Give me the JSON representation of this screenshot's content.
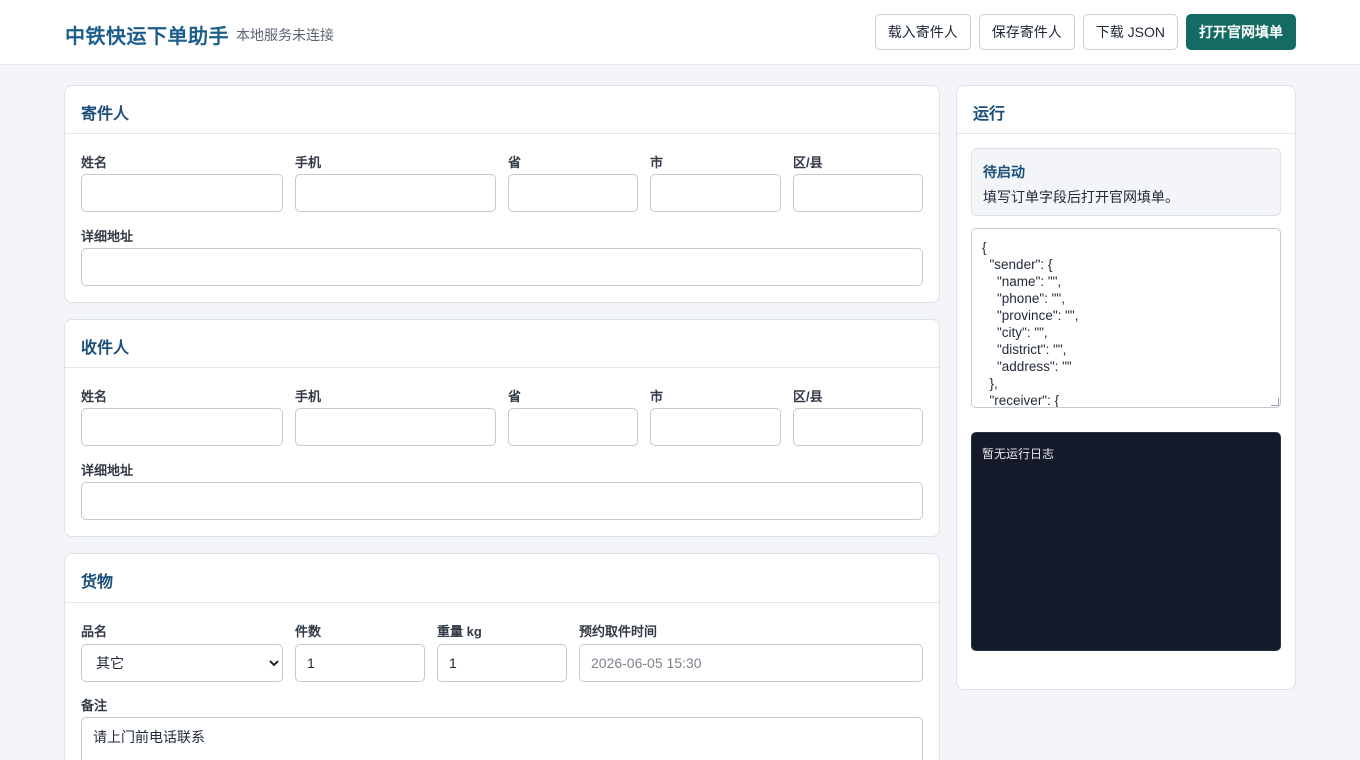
{
  "header": {
    "title": "中铁快运下单助手",
    "status": "本地服务未连接",
    "buttons": {
      "load_sender": "载入寄件人",
      "save_sender": "保存寄件人",
      "download_json": "下载 JSON",
      "open_official": "打开官网填单"
    }
  },
  "sender": {
    "title": "寄件人",
    "labels": {
      "name": "姓名",
      "phone": "手机",
      "province": "省",
      "city": "市",
      "district": "区/县",
      "address": "详细地址"
    },
    "values": {
      "name": "",
      "phone": "",
      "province": "",
      "city": "",
      "district": "",
      "address": ""
    }
  },
  "receiver": {
    "title": "收件人",
    "labels": {
      "name": "姓名",
      "phone": "手机",
      "province": "省",
      "city": "市",
      "district": "区/县",
      "address": "详细地址"
    },
    "values": {
      "name": "",
      "phone": "",
      "province": "",
      "city": "",
      "district": "",
      "address": ""
    }
  },
  "cargo": {
    "title": "货物",
    "labels": {
      "item": "品名",
      "count": "件数",
      "weight": "重量 kg",
      "pickup_time": "预约取件时间",
      "note": "备注"
    },
    "item_selected": "其它",
    "count": "1",
    "weight": "1",
    "pickup_time_placeholder": "2026-06-05 15:30",
    "note": "请上门前电话联系"
  },
  "run": {
    "title": "运行",
    "status_title": "待启动",
    "status_desc": "填写订单字段后打开官网填单。",
    "json_preview": "{\n  \"sender\": {\n    \"name\": \"\",\n    \"phone\": \"\",\n    \"province\": \"\",\n    \"city\": \"\",\n    \"district\": \"\",\n    \"address\": \"\"\n  },\n  \"receiver\": {",
    "log_text": "暂无运行日志"
  },
  "colors": {
    "brand": "#1b5e8c",
    "primary_button": "#136b63",
    "log_background": "#141a29",
    "page_background": "#f3f5f8"
  }
}
